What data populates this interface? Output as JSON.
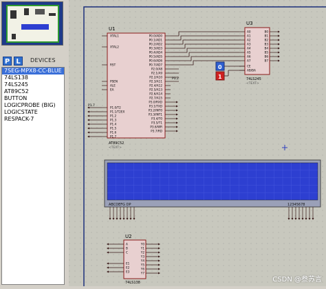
{
  "devices_panel": {
    "p_label": "P",
    "l_label": "L",
    "title": "DEVICES",
    "items": [
      {
        "label": "7SEG-MPX8-CC-BLUE",
        "selected": true
      },
      {
        "label": "74LS138",
        "selected": false
      },
      {
        "label": "74LS245",
        "selected": false
      },
      {
        "label": "AT89C52",
        "selected": false
      },
      {
        "label": "BUTTON",
        "selected": false
      },
      {
        "label": "LOGICPROBE (BIG)",
        "selected": false
      },
      {
        "label": "LOGICSTATE",
        "selected": false
      },
      {
        "label": "RESPACK-7",
        "selected": false
      }
    ]
  },
  "schematic": {
    "u1": {
      "ref": "U1",
      "part": "AT89C52",
      "text_tag": "<TEXT>",
      "left_pins": [
        "XTAL1",
        "XTAL2",
        "RST",
        "PSEN",
        "ALE",
        "EA",
        "P1.0/T2",
        "P1.1/T2EX",
        "P1.2",
        "P1.3",
        "P1.4",
        "P1.5",
        "P1.6",
        "P1.7"
      ],
      "right_pins": [
        "P0.0/AD0",
        "P0.1/AD1",
        "P0.2/AD2",
        "P0.3/AD3",
        "P0.4/AD4",
        "P0.5/AD5",
        "P0.6/AD6",
        "P0.7/AD7",
        "P2.0/A8",
        "P2.1/A9",
        "P2.2/A10",
        "P2.3/A11",
        "P2.4/A12",
        "P2.5/A13",
        "P2.6/A14",
        "P2.7/A15",
        "P3.0/RXD",
        "P3.1/TXD",
        "P3.2/INT0",
        "P3.3/INT1",
        "P3.4/T0",
        "P3.5/T1",
        "P3.6/WR",
        "P3.7/RD"
      ]
    },
    "u3": {
      "ref": "U3",
      "part": "74LS245",
      "text_tag": "<TEXT>",
      "left_pins": [
        "A0",
        "A1",
        "A2",
        "A3",
        "A4",
        "A5",
        "A6",
        "A7",
        "CE",
        "AB/BA"
      ],
      "right_pins": [
        "B0",
        "B1",
        "B2",
        "B3",
        "B4",
        "B5",
        "B6",
        "B7"
      ]
    },
    "u2": {
      "ref": "U2",
      "part": "74LS138",
      "text_tag": "<TEXT>",
      "left_pins": [
        "A",
        "B",
        "C",
        "E1",
        "E2",
        "E3"
      ],
      "right_pins": [
        "Y0",
        "Y1",
        "Y2",
        "Y3",
        "Y4",
        "Y5",
        "Y6",
        "Y7"
      ]
    },
    "logicstates": [
      "0",
      "1"
    ],
    "p1_label": "P1.7",
    "p3_label": "P3.2",
    "display": {
      "seg_label": "ABCDEFG DP",
      "digit_label": "12345678",
      "color": "#2d3fd1"
    }
  },
  "watermark": "CSDN @叁苏言"
}
